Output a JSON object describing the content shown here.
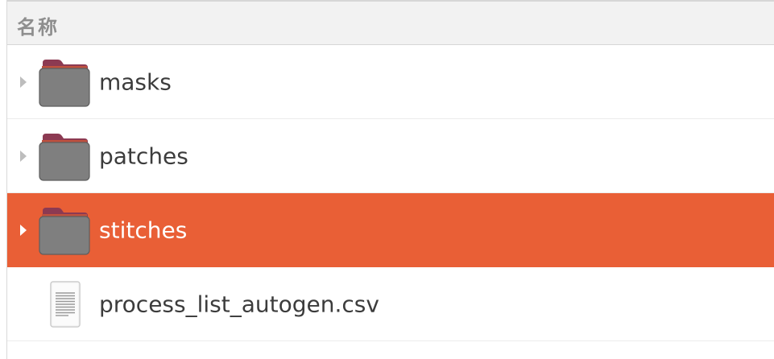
{
  "header": {
    "name_column_label": "名称"
  },
  "rows": [
    {
      "name": "masks",
      "type": "folder",
      "icon": "folder-icon",
      "expandable": true,
      "selected": false
    },
    {
      "name": "patches",
      "type": "folder",
      "icon": "folder-icon",
      "expandable": true,
      "selected": false
    },
    {
      "name": "stitches",
      "type": "folder",
      "icon": "folder-icon",
      "expandable": true,
      "selected": true
    },
    {
      "name": "process_list_autogen.csv",
      "type": "file",
      "icon": "text-file-icon",
      "expandable": false,
      "selected": false
    }
  ],
  "colors": {
    "selection": "#e95f36",
    "folder_body": "#7f7f7f",
    "folder_tab": "#8c3a52"
  }
}
